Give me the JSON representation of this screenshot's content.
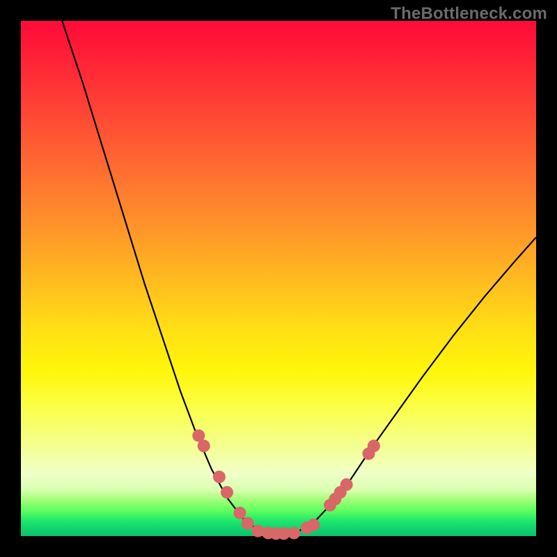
{
  "watermark": "TheBottleneck.com",
  "colors": {
    "background": "#000000",
    "curve": "#000000",
    "marker_fill": "#d96767",
    "marker_stroke": "#c85757"
  },
  "chart_data": {
    "type": "line",
    "title": "",
    "xlabel": "",
    "ylabel": "",
    "xlim": [
      0,
      100
    ],
    "ylim": [
      0,
      100
    ],
    "curve": [
      {
        "x": 8.0,
        "y": 100.0
      },
      {
        "x": 12.0,
        "y": 88.0
      },
      {
        "x": 16.0,
        "y": 75.0
      },
      {
        "x": 20.0,
        "y": 62.0
      },
      {
        "x": 24.0,
        "y": 49.0
      },
      {
        "x": 28.0,
        "y": 37.0
      },
      {
        "x": 31.0,
        "y": 28.0
      },
      {
        "x": 34.0,
        "y": 20.0
      },
      {
        "x": 37.0,
        "y": 13.0
      },
      {
        "x": 40.0,
        "y": 7.5
      },
      {
        "x": 43.0,
        "y": 3.5
      },
      {
        "x": 46.0,
        "y": 1.2
      },
      {
        "x": 48.0,
        "y": 0.5
      },
      {
        "x": 50.0,
        "y": 0.5
      },
      {
        "x": 52.0,
        "y": 0.5
      },
      {
        "x": 54.0,
        "y": 1.0
      },
      {
        "x": 57.0,
        "y": 2.8
      },
      {
        "x": 60.0,
        "y": 6.0
      },
      {
        "x": 64.0,
        "y": 11.0
      },
      {
        "x": 68.0,
        "y": 17.0
      },
      {
        "x": 73.0,
        "y": 24.0
      },
      {
        "x": 78.0,
        "y": 31.0
      },
      {
        "x": 84.0,
        "y": 39.0
      },
      {
        "x": 90.0,
        "y": 46.5
      },
      {
        "x": 96.0,
        "y": 53.5
      },
      {
        "x": 100.0,
        "y": 58.0
      }
    ],
    "markers": [
      {
        "x": 34.5,
        "y": 19.5
      },
      {
        "x": 35.5,
        "y": 17.5
      },
      {
        "x": 38.5,
        "y": 11.5
      },
      {
        "x": 40.0,
        "y": 8.5
      },
      {
        "x": 42.5,
        "y": 4.5
      },
      {
        "x": 44.0,
        "y": 2.5
      },
      {
        "x": 46.0,
        "y": 1.0
      },
      {
        "x": 48.0,
        "y": 0.6
      },
      {
        "x": 49.5,
        "y": 0.5
      },
      {
        "x": 51.0,
        "y": 0.5
      },
      {
        "x": 53.0,
        "y": 0.6
      },
      {
        "x": 55.5,
        "y": 1.6
      },
      {
        "x": 56.8,
        "y": 2.2
      },
      {
        "x": 60.0,
        "y": 6.0
      },
      {
        "x": 61.0,
        "y": 7.2
      },
      {
        "x": 62.0,
        "y": 8.5
      },
      {
        "x": 63.2,
        "y": 10.0
      },
      {
        "x": 67.5,
        "y": 16.0
      },
      {
        "x": 68.5,
        "y": 17.5
      }
    ]
  }
}
